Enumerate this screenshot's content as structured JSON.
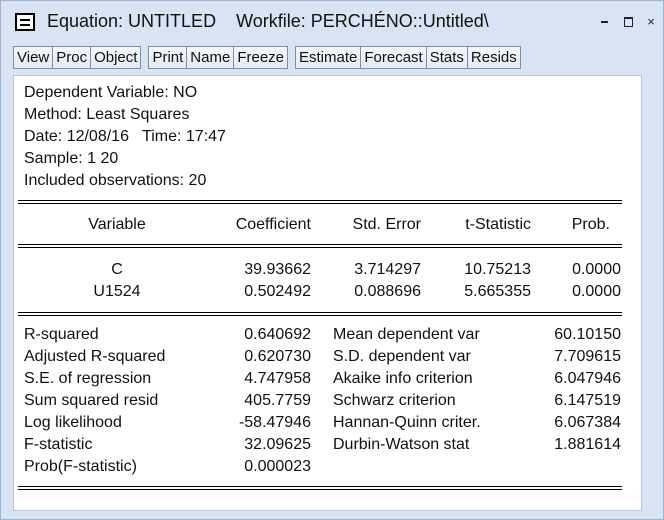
{
  "window": {
    "title": "Equation: UNTITLED    Workfile: PERCHÉNO::Untitled\\",
    "controls": {
      "minimize": "–",
      "maximize": "□",
      "close": "×"
    }
  },
  "toolbar": {
    "group1": [
      "View",
      "Proc",
      "Object"
    ],
    "group2": [
      "Print",
      "Name",
      "Freeze"
    ],
    "group3": [
      "Estimate",
      "Forecast",
      "Stats",
      "Resids"
    ]
  },
  "header": {
    "dependent": "Dependent Variable: NO",
    "method": "Method: Least Squares",
    "date": "Date: 12/08/16   Time: 17:47",
    "sample": "Sample: 1 20",
    "included": "Included observations: 20"
  },
  "coef_table": {
    "columns": [
      "Variable",
      "Coefficient",
      "Std. Error",
      "t-Statistic",
      "Prob."
    ],
    "rows": [
      [
        "C",
        "39.93662",
        "3.714297",
        "10.75213",
        "0.0000"
      ],
      [
        "U1524",
        "0.502492",
        "0.088696",
        "5.665355",
        "0.0000"
      ]
    ]
  },
  "stats": {
    "left": [
      [
        "R-squared",
        "0.640692"
      ],
      [
        "Adjusted R-squared",
        "0.620730"
      ],
      [
        "S.E. of regression",
        "4.747958"
      ],
      [
        "Sum squared resid",
        "405.7759"
      ],
      [
        "Log likelihood",
        "-58.47946"
      ],
      [
        "F-statistic",
        "32.09625"
      ],
      [
        "Prob(F-statistic)",
        "0.000023"
      ]
    ],
    "right": [
      [
        "Mean dependent var",
        "60.10150"
      ],
      [
        "S.D. dependent var",
        "7.709615"
      ],
      [
        "Akaike info criterion",
        "6.047946"
      ],
      [
        "Schwarz criterion",
        "6.147519"
      ],
      [
        "Hannan-Quinn criter.",
        "6.067384"
      ],
      [
        "Durbin-Watson stat",
        "1.881614"
      ]
    ]
  }
}
